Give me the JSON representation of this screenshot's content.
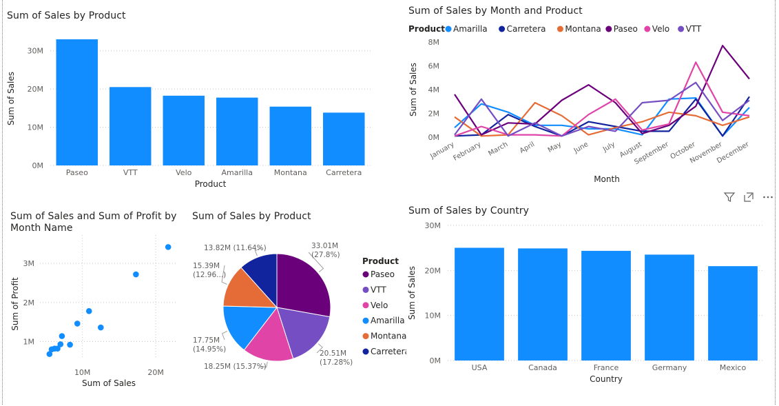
{
  "colors": {
    "Paseo": "#6B007B",
    "VTT": "#744EC2",
    "Velo": "#E044A7",
    "Amarilla": "#118DFF",
    "Montana": "#E66C37",
    "Carretera": "#12239E",
    "bar": "#118DFF",
    "grid": "#C8C6C4",
    "axis_text": "#605E5C"
  },
  "visual_header": {
    "icons": [
      "filter-icon",
      "focus-mode-icon",
      "more-options-icon"
    ]
  },
  "chart_data": [
    {
      "id": "sales_by_product",
      "type": "bar",
      "title": "Sum of Sales by Product",
      "xlabel": "Product",
      "ylabel": "Sum of Sales",
      "categories": [
        "Paseo",
        "VTT",
        "Velo",
        "Amarilla",
        "Montana",
        "Carretera"
      ],
      "values": [
        33.01,
        20.51,
        18.25,
        17.75,
        15.39,
        13.82
      ],
      "yticks": [
        "0M",
        "10M",
        "20M",
        "30M"
      ],
      "ylim": [
        0,
        35
      ],
      "grid": true
    },
    {
      "id": "sales_by_month_product",
      "type": "line",
      "title": "Sum of Sales by Month and Product",
      "xlabel": "Month",
      "ylabel": "Sum of Sales",
      "legend_title": "Product",
      "legend_position": "top-left",
      "x": [
        "January",
        "February",
        "March",
        "April",
        "May",
        "June",
        "July",
        "August",
        "September",
        "October",
        "November",
        "December"
      ],
      "yticks": [
        "0M",
        "2M",
        "4M",
        "6M",
        "8M"
      ],
      "ylim": [
        0,
        8
      ],
      "series": [
        {
          "name": "Amarilla",
          "values": [
            0.8,
            2.8,
            2.1,
            1.0,
            1.0,
            0.7,
            0.7,
            0.2,
            3.2,
            3.3,
            0.1,
            2.5
          ]
        },
        {
          "name": "Carretera",
          "values": [
            0.1,
            0.2,
            1.9,
            0.9,
            0.1,
            1.3,
            0.9,
            0.5,
            0.5,
            3.2,
            0.1,
            3.4
          ]
        },
        {
          "name": "Montana",
          "values": [
            1.7,
            0.1,
            0.2,
            2.9,
            1.8,
            0.2,
            0.8,
            1.3,
            2.1,
            1.8,
            1.0,
            1.7
          ]
        },
        {
          "name": "Paseo",
          "values": [
            3.6,
            0.2,
            1.2,
            1.1,
            3.1,
            4.4,
            2.9,
            0.3,
            1.0,
            2.6,
            7.7,
            4.9
          ]
        },
        {
          "name": "Velo",
          "values": [
            0.1,
            0.9,
            0.2,
            0.2,
            0.1,
            1.9,
            3.2,
            0.6,
            1.1,
            6.3,
            2.1,
            1.8
          ]
        },
        {
          "name": "VTT",
          "values": [
            0.2,
            3.2,
            0.1,
            1.2,
            0.1,
            0.9,
            0.5,
            2.9,
            3.1,
            4.6,
            1.4,
            3.1
          ]
        }
      ]
    },
    {
      "id": "sales_profit_by_month",
      "type": "scatter",
      "title": "Sum of Sales and Sum of Profit by Month Name",
      "title_line1": "Sum of Sales and Sum of Profit by",
      "title_line2": "Month Name",
      "xlabel": "Sum of Sales",
      "ylabel": "Sum of Profit",
      "xticks": [
        "10M",
        "20M"
      ],
      "yticks": [
        "1M",
        "2M",
        "3M"
      ],
      "xlim": [
        4.2,
        23
      ],
      "ylim": [
        0.55,
        3.55
      ],
      "points": [
        {
          "x": 21.7,
          "y": 3.42
        },
        {
          "x": 17.3,
          "y": 2.72
        },
        {
          "x": 10.9,
          "y": 1.78
        },
        {
          "x": 12.5,
          "y": 1.36
        },
        {
          "x": 9.3,
          "y": 1.46
        },
        {
          "x": 7.2,
          "y": 1.14
        },
        {
          "x": 8.3,
          "y": 0.92
        },
        {
          "x": 7.0,
          "y": 0.93
        },
        {
          "x": 6.6,
          "y": 0.82
        },
        {
          "x": 6.2,
          "y": 0.82
        },
        {
          "x": 5.8,
          "y": 0.8
        },
        {
          "x": 5.5,
          "y": 0.68
        }
      ]
    },
    {
      "id": "sales_by_product_pie",
      "type": "pie",
      "title": "Sum of Sales by Product",
      "legend_title": "Product",
      "legend_position": "right",
      "slices": [
        {
          "name": "Paseo",
          "value": 33.01,
          "label_value": "33.01M",
          "label_pct": "(27.8%)"
        },
        {
          "name": "VTT",
          "value": 20.51,
          "label_value": "20.51M",
          "label_pct": "(17.28%)"
        },
        {
          "name": "Velo",
          "value": 18.25,
          "label": "18.25M (15.37%)"
        },
        {
          "name": "Amarilla",
          "value": 17.75,
          "label_value": "17.75M",
          "label_pct": "(14.95%)"
        },
        {
          "name": "Montana",
          "value": 15.39,
          "label_value": "15.39M",
          "label_pct": "(12.96...)"
        },
        {
          "name": "Carretera",
          "value": 13.82,
          "label": "13.82M (11.64%)"
        }
      ]
    },
    {
      "id": "sales_by_country",
      "type": "bar",
      "title": "Sum of Sales by Country",
      "xlabel": "Country",
      "ylabel": "Sum of Sales",
      "categories": [
        "USA",
        "Canada",
        "France",
        "Germany",
        "Mexico"
      ],
      "values": [
        25.03,
        24.89,
        24.35,
        23.51,
        20.95
      ],
      "yticks": [
        "0M",
        "10M",
        "20M",
        "30M"
      ],
      "ylim": [
        0,
        30
      ],
      "grid": true
    }
  ]
}
